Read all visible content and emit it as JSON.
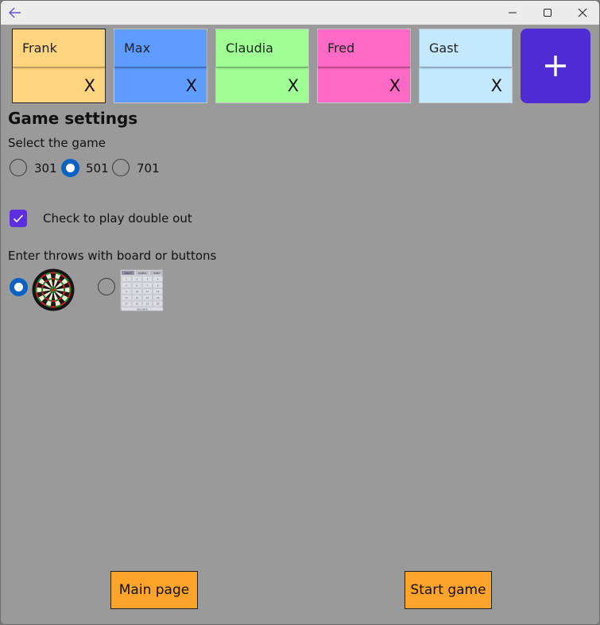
{
  "window": {
    "back_icon": "arrow-left-icon",
    "minimize_icon": "minimize-icon",
    "maximize_icon": "maximize-icon",
    "close_icon": "close-icon"
  },
  "players": [
    {
      "name": "Frank",
      "remove_label": "X",
      "color": "#ffd47f",
      "selected": true
    },
    {
      "name": "Max",
      "remove_label": "X",
      "color": "#5e9cff",
      "selected": false
    },
    {
      "name": "Claudia",
      "remove_label": "X",
      "color": "#9ffe94",
      "selected": false
    },
    {
      "name": "Fred",
      "remove_label": "X",
      "color": "#ff68c5",
      "selected": false
    },
    {
      "name": "Gast",
      "remove_label": "X",
      "color": "#c4e9ff",
      "selected": false
    }
  ],
  "add_player": {
    "icon": "plus-icon",
    "color": "#4f2bd4"
  },
  "settings": {
    "heading": "Game settings",
    "game_label": "Select the game",
    "game_options": [
      {
        "label": "301",
        "checked": false
      },
      {
        "label": "501",
        "checked": true
      },
      {
        "label": "701",
        "checked": false
      }
    ],
    "double_out_label": "Check to play double out",
    "double_out_checked": true,
    "input_label": "Enter throws with board or buttons",
    "input_options": [
      {
        "icon": "dartboard-icon",
        "checked": true
      },
      {
        "icon": "button-grid-icon",
        "checked": false
      }
    ],
    "grid_headers": [
      "SINGLE",
      "DOUBLE",
      "TRIPLE"
    ],
    "grid_footer": "BULLSEYE"
  },
  "footer": {
    "main_page_label": "Main page",
    "start_game_label": "Start game",
    "button_color": "#ffa42b"
  },
  "colors": {
    "accent": "#0a63c4",
    "checkbox": "#5b2ee0",
    "background": "#9a9a9a"
  }
}
